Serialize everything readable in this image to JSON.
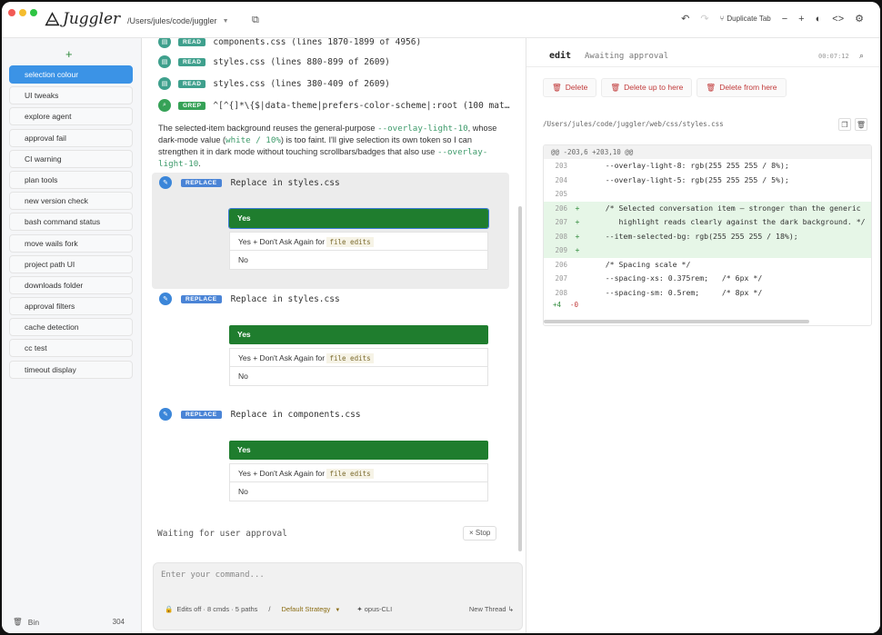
{
  "app": {
    "name": "Juggler",
    "project_path": "/Users/jules/code/juggler"
  },
  "toolbar": {
    "duplicate_tab": "Duplicate Tab"
  },
  "sidebar": {
    "items": [
      {
        "label": "selection colour",
        "active": true
      },
      {
        "label": "UI tweaks"
      },
      {
        "label": "explore agent"
      },
      {
        "label": "approval fail"
      },
      {
        "label": "CI warning"
      },
      {
        "label": "plan tools"
      },
      {
        "label": "new version check"
      },
      {
        "label": "bash command status"
      },
      {
        "label": "move wails fork"
      },
      {
        "label": "project path UI"
      },
      {
        "label": "downloads folder"
      },
      {
        "label": "approval filters"
      },
      {
        "label": "cache detection"
      },
      {
        "label": "cc test"
      },
      {
        "label": "timeout display"
      }
    ],
    "bin_label": "Bin",
    "bin_count": "304"
  },
  "chat": {
    "tools": [
      {
        "badge": "READ",
        "text": "components.css (lines 1870-1899 of 4956)"
      },
      {
        "badge": "READ",
        "text": "styles.css (lines 880-899 of 2609)"
      },
      {
        "badge": "READ",
        "text": "styles.css (lines 380-409 of 2609)"
      },
      {
        "badge": "GREP",
        "text": "^[^{]*\\{$|data-theme|prefers-color-scheme|:root (100 mat…"
      }
    ],
    "paragraph": {
      "t1": "The selected-item background reuses the general-purpose ",
      "c1": "--overlay-light-10",
      "t2": ", whose dark-mode value (",
      "c2": "white / 10%",
      "t3": ") is too faint. I'll give selection its own token so I can strengthen it in dark mode without touching scrollbars/badges that also use ",
      "c3": "--overlay-light-10",
      "t4": "."
    },
    "replaces": [
      {
        "badge": "REPLACE",
        "title": "Replace in styles.css"
      },
      {
        "badge": "REPLACE",
        "title": "Replace in styles.css"
      },
      {
        "badge": "REPLACE",
        "title": "Replace in components.css"
      }
    ],
    "approval": {
      "yes": "Yes",
      "yes_dont_ask": "Yes + Don't Ask Again for",
      "tag": "file edits",
      "no": "No"
    },
    "waiting": "Waiting for user approval",
    "stop": "Stop",
    "command_placeholder": "Enter your command...",
    "bar": {
      "edits": "Edits off · 8 cmds · 5 paths",
      "sep": "/",
      "strategy": "Default Strategy",
      "model": "opus-CLI",
      "new_thread": "New Thread"
    }
  },
  "panel": {
    "title": "edit",
    "status": "Awaiting approval",
    "time": "00:07:12",
    "buttons": {
      "delete": "Delete",
      "delete_up": "Delete up to here",
      "delete_from": "Delete from here"
    },
    "file_path": "/Users/jules/code/juggler/web/css/styles.css",
    "diff": {
      "hunk": "@@ -203,6 +203,10 @@",
      "lines": [
        {
          "ln": "203",
          "mk": "",
          "code": "    --overlay-light-8: rgb(255 255 255 / 8%);",
          "add": false
        },
        {
          "ln": "204",
          "mk": "",
          "code": "    --overlay-light-5: rgb(255 255 255 / 5%);",
          "add": false
        },
        {
          "ln": "205",
          "mk": "",
          "code": "",
          "add": false
        },
        {
          "ln": "206",
          "mk": "+",
          "code": "    /* Selected conversation item — stronger than the generic",
          "add": true
        },
        {
          "ln": "207",
          "mk": "+",
          "code": "       highlight reads clearly against the dark background. */",
          "add": true
        },
        {
          "ln": "208",
          "mk": "+",
          "code": "    --item-selected-bg: rgb(255 255 255 / 18%);",
          "add": true
        },
        {
          "ln": "209",
          "mk": "+",
          "code": "",
          "add": true
        },
        {
          "ln": "206",
          "mk": "",
          "code": "    /* Spacing scale */",
          "add": false
        },
        {
          "ln": "207",
          "mk": "",
          "code": "    --spacing-xs: 0.375rem;   /* 6px */",
          "add": false
        },
        {
          "ln": "208",
          "mk": "",
          "code": "    --spacing-sm: 0.5rem;     /* 8px */",
          "add": false
        }
      ],
      "added": "+4",
      "removed": "-0"
    }
  }
}
